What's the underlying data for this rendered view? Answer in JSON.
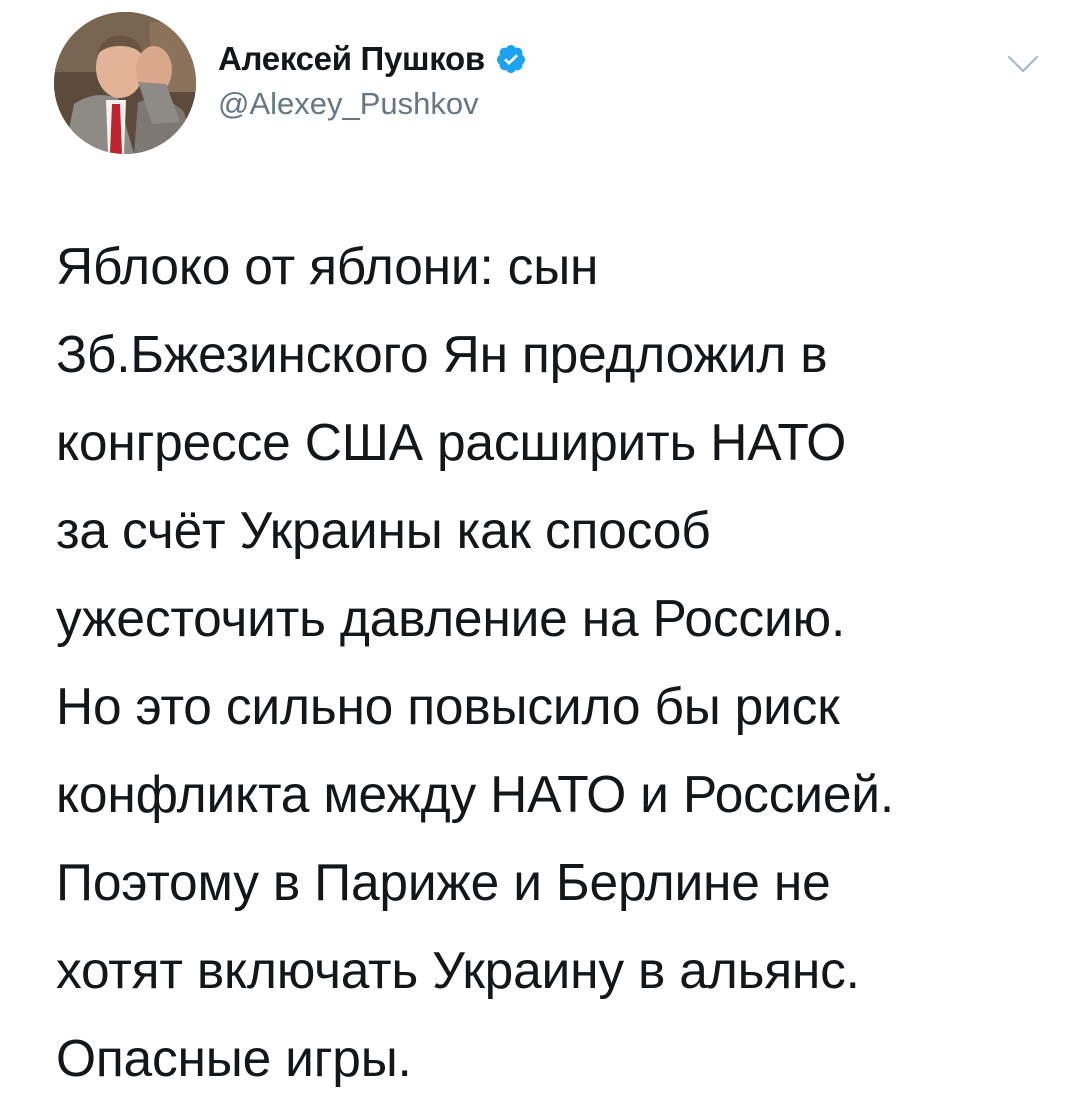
{
  "author": {
    "display_name": "Алексей Пушков",
    "handle": "@Alexey_Pushkov",
    "verified": true
  },
  "icons": {
    "verified": "verified-badge-icon",
    "menu": "chevron-down-icon"
  },
  "colors": {
    "verified_blue": "#1da1f2",
    "text": "#14171a",
    "secondary": "#657786"
  },
  "tweet": {
    "lines": [
      "Яблоко от яблони: сын",
      "Зб.Бжезинского Ян предложил в",
      "конгрессе США расширить НАТО",
      "за счёт Украины как способ",
      "ужесточить давление на Россию.",
      "Но это сильно повысило бы риск",
      "конфликта между НАТО и Россией.",
      "Поэтому в Париже и Берлине не",
      "хотят включать Украину в альянс.",
      "Опасные игры."
    ]
  }
}
